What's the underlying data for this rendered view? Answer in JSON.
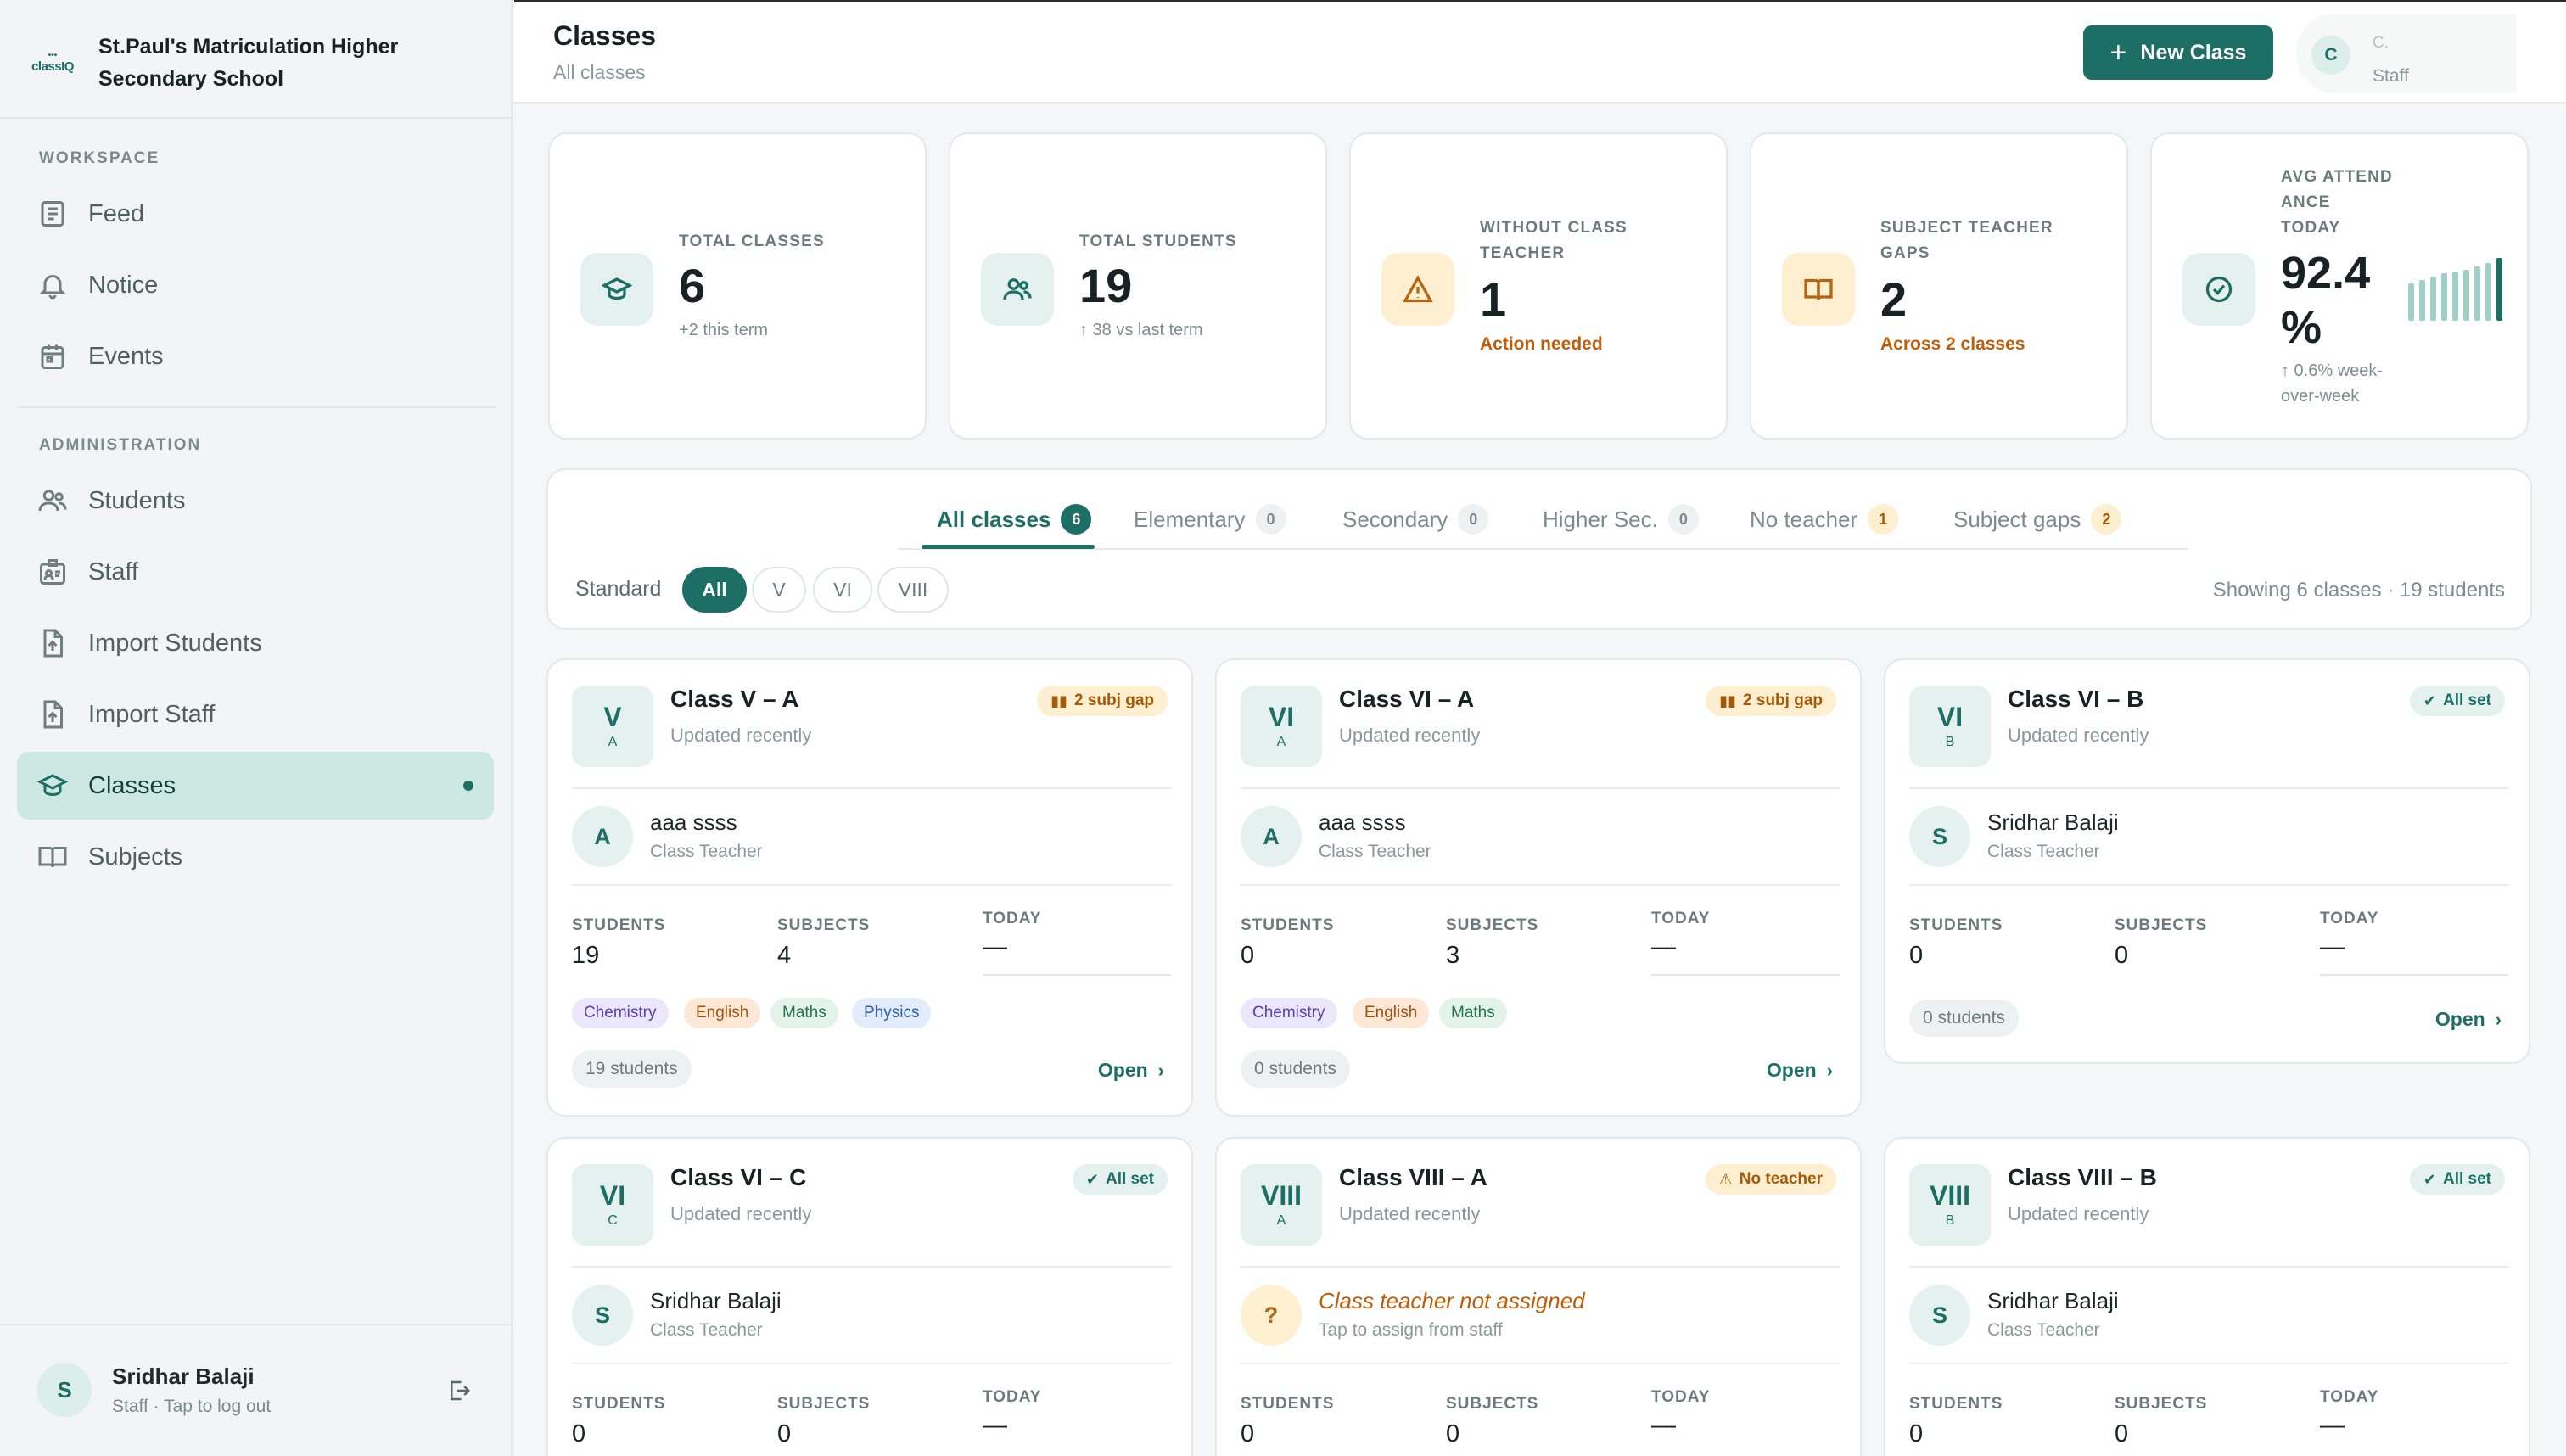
{
  "brand": {
    "logo_small": "•••",
    "logo_text": "classIQ",
    "school_name": "St.Paul's Matriculation Higher Secondary School"
  },
  "sidebar": {
    "workspace_label": "WORKSPACE",
    "admin_label": "ADMINISTRATION",
    "workspace_items": [
      {
        "label": "Feed",
        "icon": "feed-icon"
      },
      {
        "label": "Notice",
        "icon": "bell-icon"
      },
      {
        "label": "Events",
        "icon": "calendar-icon"
      }
    ],
    "admin_items": [
      {
        "label": "Students",
        "icon": "users-icon"
      },
      {
        "label": "Staff",
        "icon": "staff-badge-icon"
      },
      {
        "label": "Import Students",
        "icon": "file-import-icon"
      },
      {
        "label": "Import Staff",
        "icon": "file-import-icon"
      },
      {
        "label": "Classes",
        "icon": "graduation-cap-icon",
        "active": true
      },
      {
        "label": "Subjects",
        "icon": "book-icon"
      }
    ],
    "user": {
      "initial": "S",
      "name": "Sridhar Balaji",
      "subtitle": "Staff · Tap to log out"
    }
  },
  "header": {
    "title": "Classes",
    "subtitle": "All classes",
    "new_button": "New Class",
    "user_initial": "C",
    "user_name": "C.",
    "user_role": "Staff"
  },
  "stats": [
    {
      "label": "TOTAL CLASSES",
      "value": "6",
      "note": "+2 this term",
      "icon": "graduation-cap-icon"
    },
    {
      "label": "TOTAL STUDENTS",
      "value": "19",
      "note": "↑ 38 vs last term",
      "icon": "users-icon"
    },
    {
      "label_1": "WITHOUT CLASS",
      "label_2": "TEACHER",
      "value": "1",
      "note": "Action needed",
      "icon": "warning-icon"
    },
    {
      "label_1": "SUBJECT TEACHER",
      "label_2": "GAPS",
      "value": "2",
      "note": "Across 2 classes",
      "icon": "open-book-icon"
    },
    {
      "label_1": "AVG ATTEND",
      "label_2": "ANCE",
      "label_3": "TODAY",
      "value_1": "92.4",
      "value_2": "%",
      "note_1": "↑ 0.6% week-",
      "note_2": "over-week",
      "icon": "check-circle-icon",
      "trend": [
        0.55,
        0.6,
        0.65,
        0.7,
        0.72,
        0.75,
        0.8,
        0.85,
        0.92
      ]
    }
  ],
  "filters": {
    "tabs": [
      {
        "label": "All classes",
        "count": "6"
      },
      {
        "label": "Elementary",
        "count": "0"
      },
      {
        "label": "Secondary",
        "count": "0"
      },
      {
        "label": "Higher Sec.",
        "count": "0"
      },
      {
        "label": "No teacher",
        "count": "1"
      },
      {
        "label": "Subject gaps",
        "count": "2"
      }
    ],
    "standard_label": "Standard",
    "standards": [
      "All",
      "V",
      "VI",
      "VIII"
    ],
    "showing": "Showing 6 classes · 19 students"
  },
  "labels": {
    "students": "STUDENTS",
    "subjects": "SUBJECTS",
    "today": "TODAY",
    "open": "Open"
  },
  "classes": [
    {
      "std": "V",
      "sec": "A",
      "title": "Class V – A",
      "updated": "Updated recently",
      "status": "2 subj gap",
      "teacher_initial": "A",
      "teacher": "aaa ssss",
      "teacher_role": "Class Teacher",
      "students": "19",
      "subjects": "4",
      "today": "—",
      "chips": [
        "Chemistry",
        "English",
        "Maths",
        "Physics"
      ],
      "count": "19 students"
    },
    {
      "std": "VI",
      "sec": "A",
      "title": "Class VI – A",
      "updated": "Updated recently",
      "status": "2 subj gap",
      "teacher_initial": "A",
      "teacher": "aaa ssss",
      "teacher_role": "Class Teacher",
      "students": "0",
      "subjects": "3",
      "today": "—",
      "chips": [
        "Chemistry",
        "English",
        "Maths"
      ],
      "count": "0 students"
    },
    {
      "std": "VI",
      "sec": "B",
      "title": "Class VI – B",
      "updated": "Updated recently",
      "status": "All set",
      "teacher_initial": "S",
      "teacher": "Sridhar Balaji",
      "teacher_role": "Class Teacher",
      "students": "0",
      "subjects": "0",
      "today": "—",
      "count": "0 students"
    },
    {
      "std": "VI",
      "sec": "C",
      "title": "Class VI – C",
      "updated": "Updated recently",
      "status": "All set",
      "teacher_initial": "S",
      "teacher": "Sridhar Balaji",
      "teacher_role": "Class Teacher",
      "students": "0",
      "subjects": "0",
      "today": "—"
    },
    {
      "std": "VIII",
      "sec": "A",
      "title": "Class VIII – A",
      "updated": "Updated recently",
      "status": "No teacher",
      "teacher_initial": "?",
      "teacher": "Class teacher not assigned",
      "teacher_role": "Tap to assign from staff",
      "students": "0",
      "subjects": "0",
      "today": "—"
    },
    {
      "std": "VIII",
      "sec": "B",
      "title": "Class VIII – B",
      "updated": "Updated recently",
      "status": "All set",
      "teacher_initial": "S",
      "teacher": "Sridhar Balaji",
      "teacher_role": "Class Teacher",
      "students": "0",
      "subjects": "0",
      "today": "—"
    }
  ],
  "colors": {
    "accent": "#1d6f66",
    "accent_soft": "#e4f1ef",
    "warn": "#c05d0a",
    "warn_soft": "#fdefcf"
  }
}
